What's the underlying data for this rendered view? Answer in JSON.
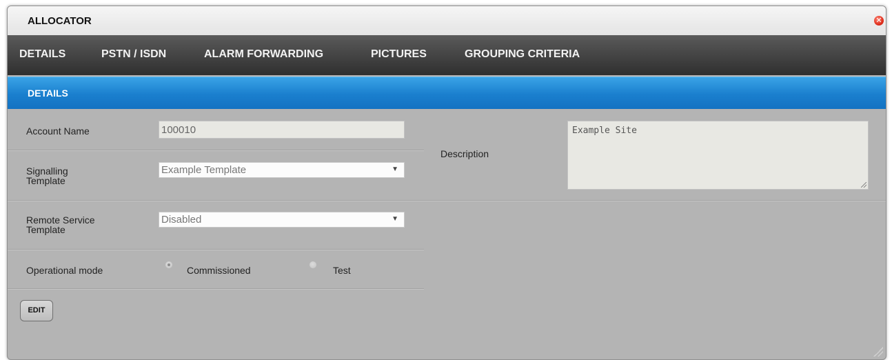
{
  "window": {
    "title": "ALLOCATOR"
  },
  "nav": {
    "tabs": [
      {
        "label": "DETAILS"
      },
      {
        "label": "PSTN / ISDN"
      },
      {
        "label": "ALARM FORWARDING"
      },
      {
        "label": "PICTURES"
      },
      {
        "label": "GROUPING CRITERIA"
      }
    ]
  },
  "section": {
    "title": "DETAILS"
  },
  "form": {
    "account_name": {
      "label": "Account Name",
      "value": "100010"
    },
    "signalling_template": {
      "label_line1": "Signalling",
      "label_line2": "Template",
      "value": "Example Template"
    },
    "remote_service_template": {
      "label_line1": "Remote Service",
      "label_line2": "Template",
      "value": "Disabled"
    },
    "operational_mode": {
      "label": "Operational mode",
      "options": [
        {
          "label": "Commissioned",
          "checked": true
        },
        {
          "label": "Test",
          "checked": false
        }
      ]
    },
    "description": {
      "label": "Description",
      "value": "Example Site"
    }
  },
  "actions": {
    "edit_label": "EDIT"
  },
  "colors": {
    "nav_bg": "#3a3a3a",
    "section_bg": "#1a7fce",
    "panel_bg": "#b4b4b4",
    "close": "#e0301e"
  },
  "icons": {
    "close": "close-icon",
    "dropdown": "chevron-down-icon",
    "resize": "resize-grip-icon"
  }
}
